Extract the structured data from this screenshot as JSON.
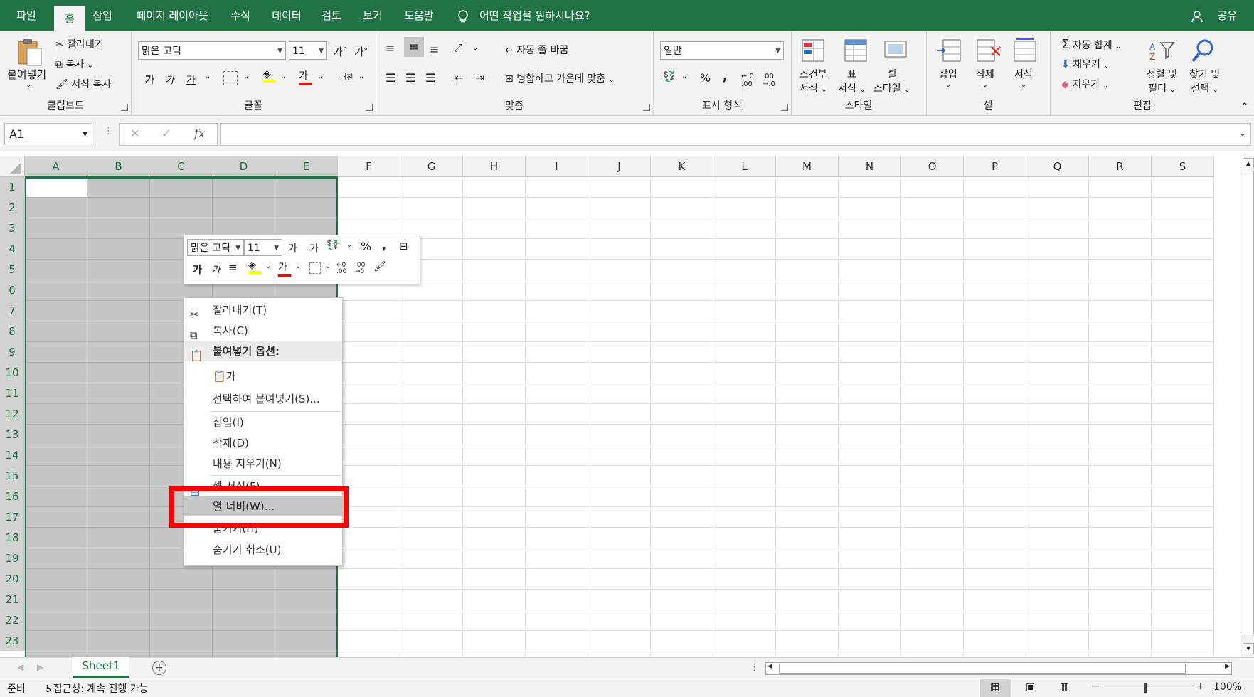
{
  "menu": {
    "tabs": [
      "파일",
      "홈",
      "삽입",
      "페이지 레이아웃",
      "수식",
      "데이터",
      "검토",
      "보기",
      "도움말"
    ],
    "active_tab": "홈",
    "tell_me": "어떤 작업을 원하시나요?",
    "share": "공유"
  },
  "ribbon": {
    "clipboard": {
      "label": "클립보드",
      "paste": "붙여넣기",
      "cut": "잘라내기",
      "copy": "복사",
      "format_painter": "서식 복사"
    },
    "font": {
      "label": "글꼴",
      "font_name": "맑은 고딕",
      "font_size": "11",
      "grow": "가",
      "shrink": "가",
      "bold": "가",
      "italic": "가",
      "underline": "가",
      "font_color_sample": "가",
      "phonetic": "내천"
    },
    "alignment": {
      "label": "맞춤",
      "wrap_text": "자동 줄 바꿈",
      "merge_center": "병합하고 가운데 맞춤"
    },
    "number": {
      "label": "표시 형식",
      "format": "일반",
      "percent": "%",
      "comma": ","
    },
    "styles": {
      "label": "스타일",
      "conditional_1": "조건부",
      "conditional_2": "서식",
      "table_1": "표",
      "table_2": "서식",
      "cell_1": "셀",
      "cell_2": "스타일"
    },
    "cells": {
      "label": "셀",
      "insert": "삽입",
      "delete": "삭제",
      "format": "서식"
    },
    "editing": {
      "label": "편집",
      "autosum": "자동 합계",
      "fill": "채우기",
      "clear": "지우기",
      "sort_1": "정렬 및",
      "sort_2": "필터",
      "find_1": "찾기 및",
      "find_2": "선택"
    }
  },
  "formula_bar": {
    "name_box": "A1",
    "fx": "fx"
  },
  "sheet": {
    "columns": [
      "A",
      "B",
      "C",
      "D",
      "E",
      "F",
      "G",
      "H",
      "I",
      "J",
      "K",
      "L",
      "M",
      "N",
      "O",
      "P",
      "Q",
      "R",
      "S"
    ],
    "rows": [
      "1",
      "2",
      "3",
      "4",
      "5",
      "6",
      "7",
      "8",
      "9",
      "10",
      "11",
      "12",
      "13",
      "14",
      "15",
      "16",
      "17",
      "18",
      "19",
      "20",
      "21",
      "22",
      "23"
    ],
    "selected_columns": [
      "A",
      "B",
      "C",
      "D",
      "E"
    ]
  },
  "mini_toolbar": {
    "font_name": "맑은 고딕",
    "font_size": "11",
    "grow": "가",
    "shrink": "가",
    "percent": "%",
    "comma": ",",
    "bold": "가",
    "italic": "가",
    "font_color_sample": "가"
  },
  "context_menu": {
    "items": [
      {
        "label": "잘라내기(T)"
      },
      {
        "label": "복사(C)"
      },
      {
        "label": "붙여넣기 옵션:"
      },
      {
        "label": "가"
      },
      {
        "label": "선택하여 붙여넣기(S)..."
      },
      {
        "label": "삽입(I)"
      },
      {
        "label": "삭제(D)"
      },
      {
        "label": "내용 지우기(N)"
      },
      {
        "label": "셀 서식(F)..."
      },
      {
        "label": "열 너비(W)..."
      },
      {
        "label": "숨기기(H)"
      },
      {
        "label": "숨기기 취소(U)"
      }
    ],
    "highlight_color": "#ff0000"
  },
  "sheet_tabs": {
    "active": "Sheet1",
    "add": "+"
  },
  "status": {
    "ready": "준비",
    "accessibility": "접근성: 계속 진행 가능",
    "zoom": "100%"
  },
  "colors": {
    "accent": "#217346",
    "ribbon_bg": "#f3f3f3"
  }
}
